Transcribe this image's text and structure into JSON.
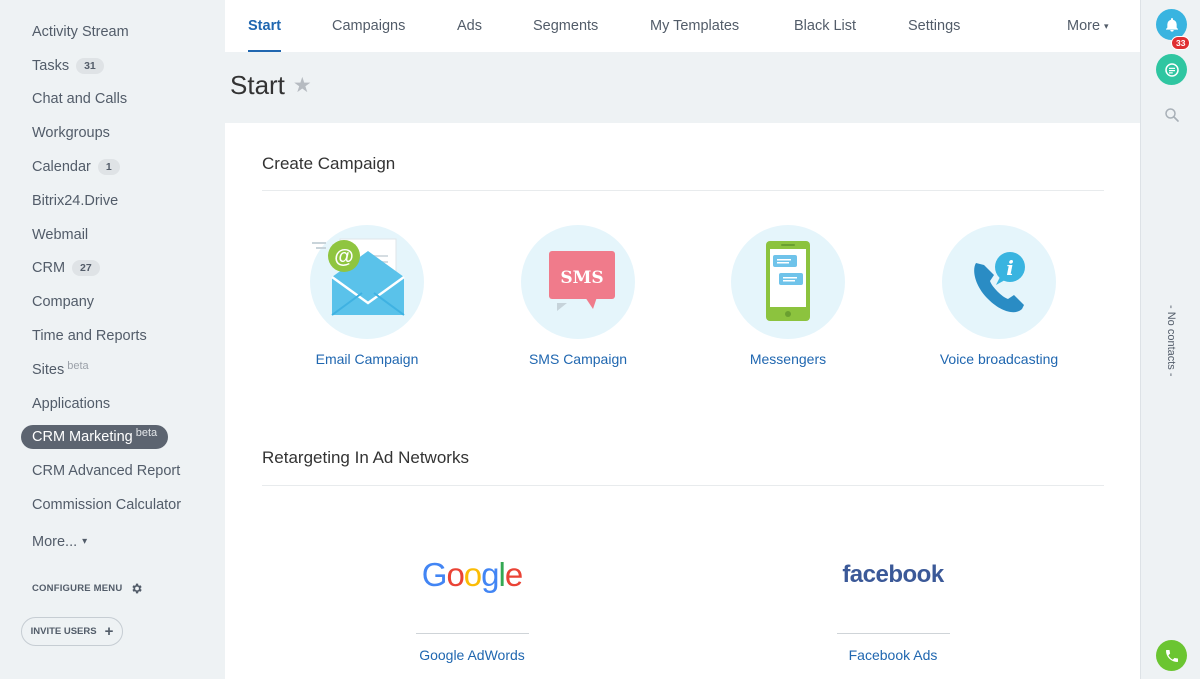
{
  "sidebar": {
    "items": [
      {
        "label": "Activity Stream"
      },
      {
        "label": "Tasks",
        "count": "31"
      },
      {
        "label": "Chat and Calls"
      },
      {
        "label": "Workgroups"
      },
      {
        "label": "Calendar",
        "count": "1"
      },
      {
        "label": "Bitrix24.Drive"
      },
      {
        "label": "Webmail"
      },
      {
        "label": "CRM",
        "count": "27"
      },
      {
        "label": "Company"
      },
      {
        "label": "Time and Reports"
      },
      {
        "label": "Sites",
        "sup": "beta"
      },
      {
        "label": "Applications"
      },
      {
        "label": "CRM Marketing",
        "sup": "beta",
        "active": true
      },
      {
        "label": "CRM Advanced Report"
      },
      {
        "label": "Commission Calculator"
      }
    ],
    "more_label": "More...",
    "configure_label": "CONFIGURE MENU",
    "invite_label": "INVITE USERS"
  },
  "topnav": {
    "tabs": [
      {
        "label": "Start",
        "active": true
      },
      {
        "label": "Campaigns"
      },
      {
        "label": "Ads"
      },
      {
        "label": "Segments"
      },
      {
        "label": "My Templates"
      },
      {
        "label": "Black List"
      },
      {
        "label": "Settings"
      }
    ],
    "more_label": "More"
  },
  "page": {
    "title": "Start"
  },
  "create_campaign": {
    "title": "Create Campaign",
    "tiles": [
      {
        "label": "Email Campaign",
        "icon": "email-campaign-icon"
      },
      {
        "label": "SMS Campaign",
        "icon": "sms-campaign-icon",
        "icon_text": "SMS"
      },
      {
        "label": "Messengers",
        "icon": "messengers-icon"
      },
      {
        "label": "Voice broadcasting",
        "icon": "voice-broadcasting-icon"
      }
    ]
  },
  "retargeting": {
    "title": "Retargeting In Ad Networks",
    "networks": [
      {
        "logo_text": "Google",
        "label": "Google AdWords"
      },
      {
        "logo_text": "facebook",
        "label": "Facebook Ads"
      }
    ]
  },
  "rightbar": {
    "notifications_count": "33",
    "no_contacts": "- No contacts -"
  },
  "colors": {
    "accent_blue": "#2067b0",
    "teal": "#2fc6a1",
    "phone_green": "#6bc531",
    "notif_red": "#e02f32"
  }
}
